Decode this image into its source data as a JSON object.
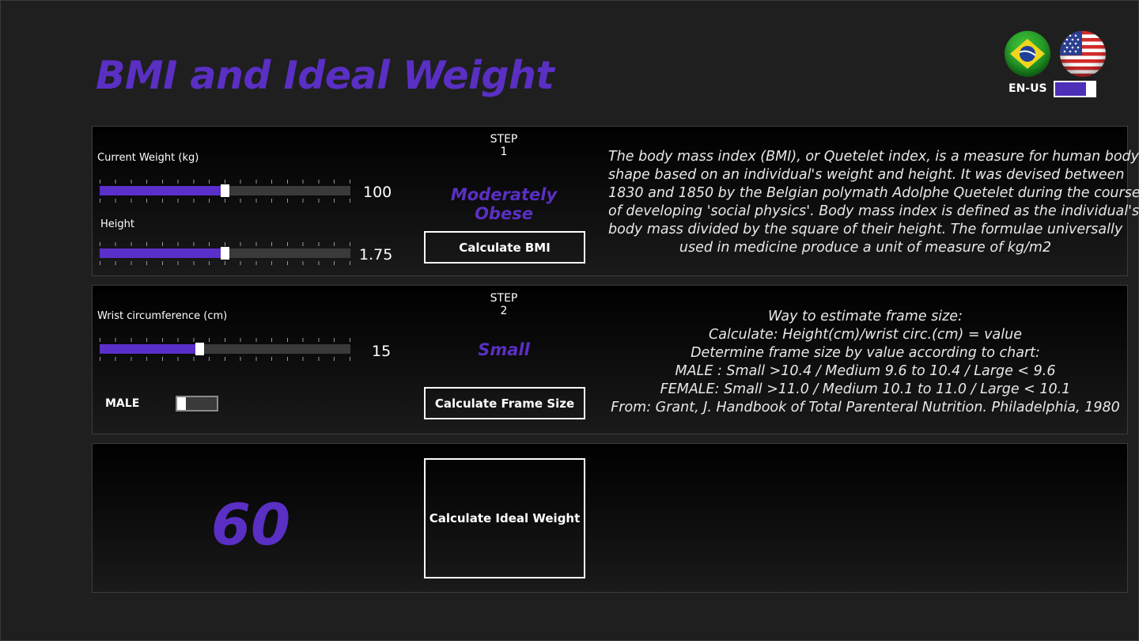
{
  "app": {
    "title": "BMI and Ideal Weight",
    "language_label": "EN-US",
    "flags": [
      "brazil-flag-icon",
      "usa-flag-icon"
    ],
    "accent_color": "#5a2fc4"
  },
  "step1": {
    "label": "STEP 1",
    "weight": {
      "label": "Current Weight (kg)",
      "value": "100",
      "level": 0.5
    },
    "height": {
      "label": "Height",
      "value": "1.75",
      "level": 0.5
    },
    "result": "Moderately Obese",
    "button": "Calculate BMI",
    "info": [
      "The body mass index (BMI), or Quetelet index, is a measure for human body",
      "shape based on an individual's weight and height. It was devised between",
      "1830 and 1850 by the Belgian polymath Adolphe Quetelet during the course",
      "of developing 'social physics'. Body mass index is defined as the individual's",
      "body mass divided by the square of their height. The formulae universally",
      "used in medicine produce a unit of measure of kg/m2"
    ]
  },
  "step2": {
    "label": "STEP 2",
    "wrist": {
      "label": "Wrist circumference (cm)",
      "value": "15",
      "level": 0.4
    },
    "sex_label": "MALE",
    "result": "Small",
    "button": "Calculate Frame Size",
    "info": [
      "Way to estimate frame size:",
      "Calculate: Height(cm)/wrist circ.(cm) = value",
      "Determine frame size by value according to chart:",
      "MALE  : Small >10.4 / Medium  9.6 to 10.4 / Large <  9.6",
      "FEMALE: Small >11.0 / Medium 10.1 to 11.0 / Large < 10.1",
      "From: Grant, J. Handbook of Total Parenteral Nutrition. Philadelphia, 1980"
    ]
  },
  "step3": {
    "ideal_weight": "60",
    "button": "Calculate Ideal Weight"
  }
}
